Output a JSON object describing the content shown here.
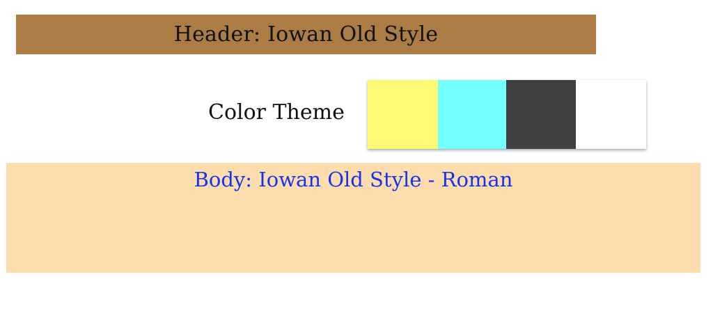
{
  "header": {
    "title": "Header: Iowan Old Style",
    "background": "#ab7c44"
  },
  "color_theme": {
    "label": "Color Theme",
    "swatches": [
      {
        "color": "#fffa73"
      },
      {
        "color": "#73ffff"
      },
      {
        "color": "#404040"
      },
      {
        "color": "#ffffff"
      }
    ]
  },
  "body": {
    "text": "Body: Iowan Old Style - Roman",
    "background": "#fddcad",
    "text_color": "#1633ee"
  }
}
